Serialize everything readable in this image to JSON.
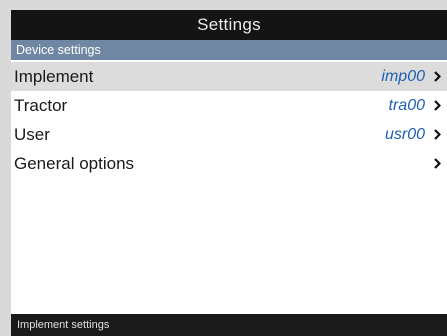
{
  "title": "Settings",
  "section": "Device settings",
  "items": [
    {
      "label": "Implement",
      "value": "imp00",
      "selected": true
    },
    {
      "label": "Tractor",
      "value": "tra00",
      "selected": false
    },
    {
      "label": "User",
      "value": "usr00",
      "selected": false
    },
    {
      "label": "General options",
      "value": "",
      "selected": false
    }
  ],
  "status": "Implement settings",
  "colors": {
    "title_bar": "#141414",
    "section_header": "#6f87a2",
    "value_text": "#1f5fb3",
    "selected_row": "#dcdcdc"
  },
  "icons": {
    "row_arrow": "chevron-right-icon"
  }
}
